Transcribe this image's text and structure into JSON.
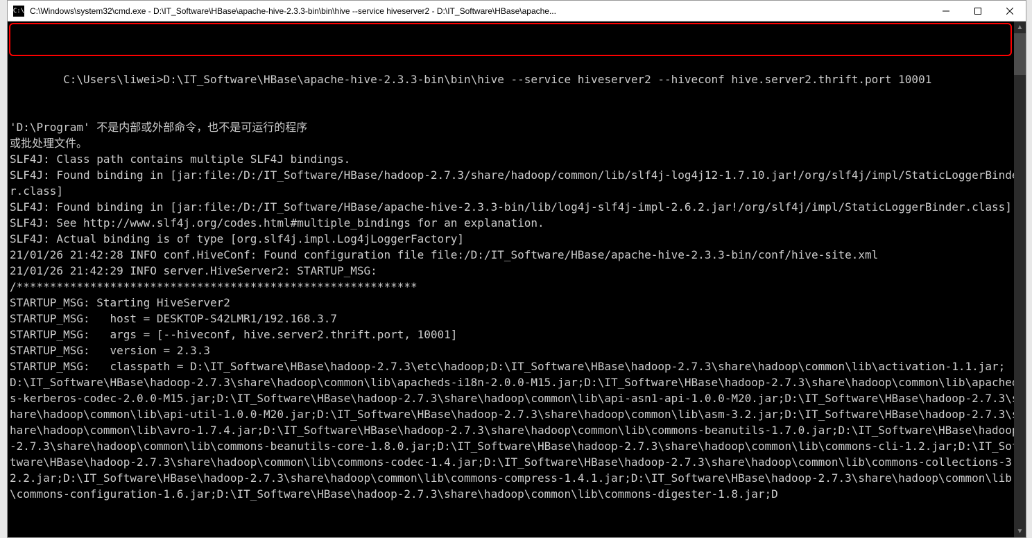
{
  "window": {
    "icon_text": "C:\\",
    "title": "C:\\Windows\\system32\\cmd.exe - D:\\IT_Software\\HBase\\apache-hive-2.3.3-bin\\bin\\hive  --service hiveserver2 - D:\\IT_Software\\HBase\\apache..."
  },
  "terminal": {
    "prompt_line": "C:\\Users\\liwei>D:\\IT_Software\\HBase\\apache-hive-2.3.3-bin\\bin\\hive --service hiveserver2 --hiveconf hive.server2.thrift.port 10001",
    "lines": [
      "",
      "'D:\\Program' 不是内部或外部命令，也不是可运行的程序",
      "或批处理文件。",
      "SLF4J: Class path contains multiple SLF4J bindings.",
      "SLF4J: Found binding in [jar:file:/D:/IT_Software/HBase/hadoop-2.7.3/share/hadoop/common/lib/slf4j-log4j12-1.7.10.jar!/org/slf4j/impl/StaticLoggerBinder.class]",
      "SLF4J: Found binding in [jar:file:/D:/IT_Software/HBase/apache-hive-2.3.3-bin/lib/log4j-slf4j-impl-2.6.2.jar!/org/slf4j/impl/StaticLoggerBinder.class]",
      "SLF4J: See http://www.slf4j.org/codes.html#multiple_bindings for an explanation.",
      "SLF4J: Actual binding is of type [org.slf4j.impl.Log4jLoggerFactory]",
      "21/01/26 21:42:28 INFO conf.HiveConf: Found configuration file file:/D:/IT_Software/HBase/apache-hive-2.3.3-bin/conf/hive-site.xml",
      "21/01/26 21:42:29 INFO server.HiveServer2: STARTUP_MSG:",
      "/************************************************************",
      "STARTUP_MSG: Starting HiveServer2",
      "STARTUP_MSG:   host = DESKTOP-S42LMR1/192.168.3.7",
      "STARTUP_MSG:   args = [--hiveconf, hive.server2.thrift.port, 10001]",
      "STARTUP_MSG:   version = 2.3.3",
      "STARTUP_MSG:   classpath = D:\\IT_Software\\HBase\\hadoop-2.7.3\\etc\\hadoop;D:\\IT_Software\\HBase\\hadoop-2.7.3\\share\\hadoop\\common\\lib\\activation-1.1.jar;D:\\IT_Software\\HBase\\hadoop-2.7.3\\share\\hadoop\\common\\lib\\apacheds-i18n-2.0.0-M15.jar;D:\\IT_Software\\HBase\\hadoop-2.7.3\\share\\hadoop\\common\\lib\\apacheds-kerberos-codec-2.0.0-M15.jar;D:\\IT_Software\\HBase\\hadoop-2.7.3\\share\\hadoop\\common\\lib\\api-asn1-api-1.0.0-M20.jar;D:\\IT_Software\\HBase\\hadoop-2.7.3\\share\\hadoop\\common\\lib\\api-util-1.0.0-M20.jar;D:\\IT_Software\\HBase\\hadoop-2.7.3\\share\\hadoop\\common\\lib\\asm-3.2.jar;D:\\IT_Software\\HBase\\hadoop-2.7.3\\share\\hadoop\\common\\lib\\avro-1.7.4.jar;D:\\IT_Software\\HBase\\hadoop-2.7.3\\share\\hadoop\\common\\lib\\commons-beanutils-1.7.0.jar;D:\\IT_Software\\HBase\\hadoop-2.7.3\\share\\hadoop\\common\\lib\\commons-beanutils-core-1.8.0.jar;D:\\IT_Software\\HBase\\hadoop-2.7.3\\share\\hadoop\\common\\lib\\commons-cli-1.2.jar;D:\\IT_Software\\HBase\\hadoop-2.7.3\\share\\hadoop\\common\\lib\\commons-codec-1.4.jar;D:\\IT_Software\\HBase\\hadoop-2.7.3\\share\\hadoop\\common\\lib\\commons-collections-3.2.2.jar;D:\\IT_Software\\HBase\\hadoop-2.7.3\\share\\hadoop\\common\\lib\\commons-compress-1.4.1.jar;D:\\IT_Software\\HBase\\hadoop-2.7.3\\share\\hadoop\\common\\lib\\commons-configuration-1.6.jar;D:\\IT_Software\\HBase\\hadoop-2.7.3\\share\\hadoop\\common\\lib\\commons-digester-1.8.jar;D"
    ]
  }
}
